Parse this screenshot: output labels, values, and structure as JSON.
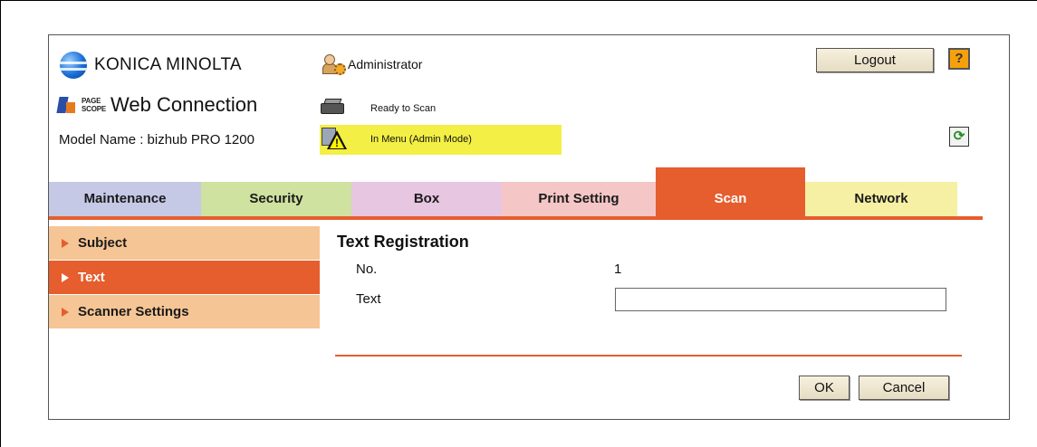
{
  "header": {
    "brand": "KONICA MINOLTA",
    "pagescope_top": "PAGE",
    "pagescope_bottom": "SCOPE",
    "web_connection": "Web Connection",
    "model_name": "Model Name : bizhub PRO 1200",
    "user": "Administrator",
    "logout_label": "Logout",
    "help_label": "?",
    "printer_status": "Ready to Scan",
    "mode_status": "In Menu (Admin Mode)",
    "warn_mark": "!",
    "refresh_glyph": "⟳"
  },
  "tabs": [
    {
      "label": "Maintenance",
      "color": "#c5c9e6"
    },
    {
      "label": "Security",
      "color": "#cfe2a0"
    },
    {
      "label": "Box",
      "color": "#e6c6e0"
    },
    {
      "label": "Print Setting",
      "color": "#f5c6c6"
    },
    {
      "label": "Scan",
      "color": "#e65d2e",
      "active": true
    },
    {
      "label": "Network",
      "color": "#f5f0a3"
    }
  ],
  "sidebar": {
    "items": [
      {
        "label": "Subject",
        "active": false
      },
      {
        "label": "Text",
        "active": true
      },
      {
        "label": "Scanner Settings",
        "active": false
      }
    ]
  },
  "main": {
    "title": "Text Registration",
    "no_label": "No.",
    "no_value": "1",
    "text_label": "Text",
    "text_value": ""
  },
  "buttons": {
    "ok": "OK",
    "cancel": "Cancel"
  },
  "colors": {
    "accent": "#e65d2e",
    "sidebar_bg": "#f6c595",
    "status_highlight": "#f3ef44"
  },
  "icons": {
    "logo": "konica-minolta-globe-icon",
    "pagescope": "pagescope-icon",
    "admin": "administrator-icon",
    "printer": "printer-icon",
    "warning": "warning-icon",
    "help": "help-icon",
    "refresh": "refresh-icon"
  }
}
